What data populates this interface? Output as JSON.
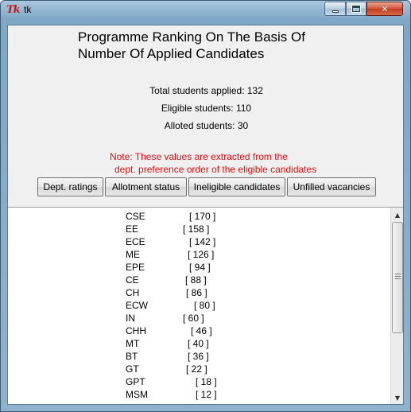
{
  "window": {
    "title": "tk",
    "icon": "tk-feather-icon"
  },
  "heading": {
    "line1": "Programme Ranking On The Basis Of",
    "line2": "Number Of Applied Candidates"
  },
  "stats": {
    "total": "Total students applied: 132",
    "eligible": "Eligible students: 110",
    "alloted": "Alloted students: 30"
  },
  "note": {
    "line1": "Note: These values are extracted from the",
    "line2": "dept. preference order of the eligible candidates"
  },
  "buttons": {
    "dept_ratings": "Dept. ratings",
    "allotment_status": "Allotment status",
    "ineligible_candidates": "Ineligible candidates",
    "unfilled_vacancies": "Unfilled vacancies"
  },
  "programmes": [
    {
      "name": "CSE",
      "count": "[ 170 ]"
    },
    {
      "name": "EE",
      "count": "[ 158 ]"
    },
    {
      "name": "ECE",
      "count": "[ 142 ]"
    },
    {
      "name": "ME",
      "count": "[ 126 ]"
    },
    {
      "name": "EPE",
      "count": "[ 94 ]"
    },
    {
      "name": "CE",
      "count": "[ 88 ]"
    },
    {
      "name": "CH",
      "count": "[ 86 ]"
    },
    {
      "name": "ECW",
      "count": "[ 80 ]"
    },
    {
      "name": "IN",
      "count": "[ 60 ]"
    },
    {
      "name": "CHH",
      "count": "[ 46 ]"
    },
    {
      "name": "MT",
      "count": "[ 40 ]"
    },
    {
      "name": "BT",
      "count": "[ 36 ]"
    },
    {
      "name": "GT",
      "count": "[ 22 ]"
    },
    {
      "name": "GPT",
      "count": "[ 18 ]"
    },
    {
      "name": "MSM",
      "count": "[ 12 ]"
    }
  ],
  "colors": {
    "note_text": "#e01010",
    "client_bg": "#f0f0f0",
    "close_button": "#c23b1f"
  }
}
